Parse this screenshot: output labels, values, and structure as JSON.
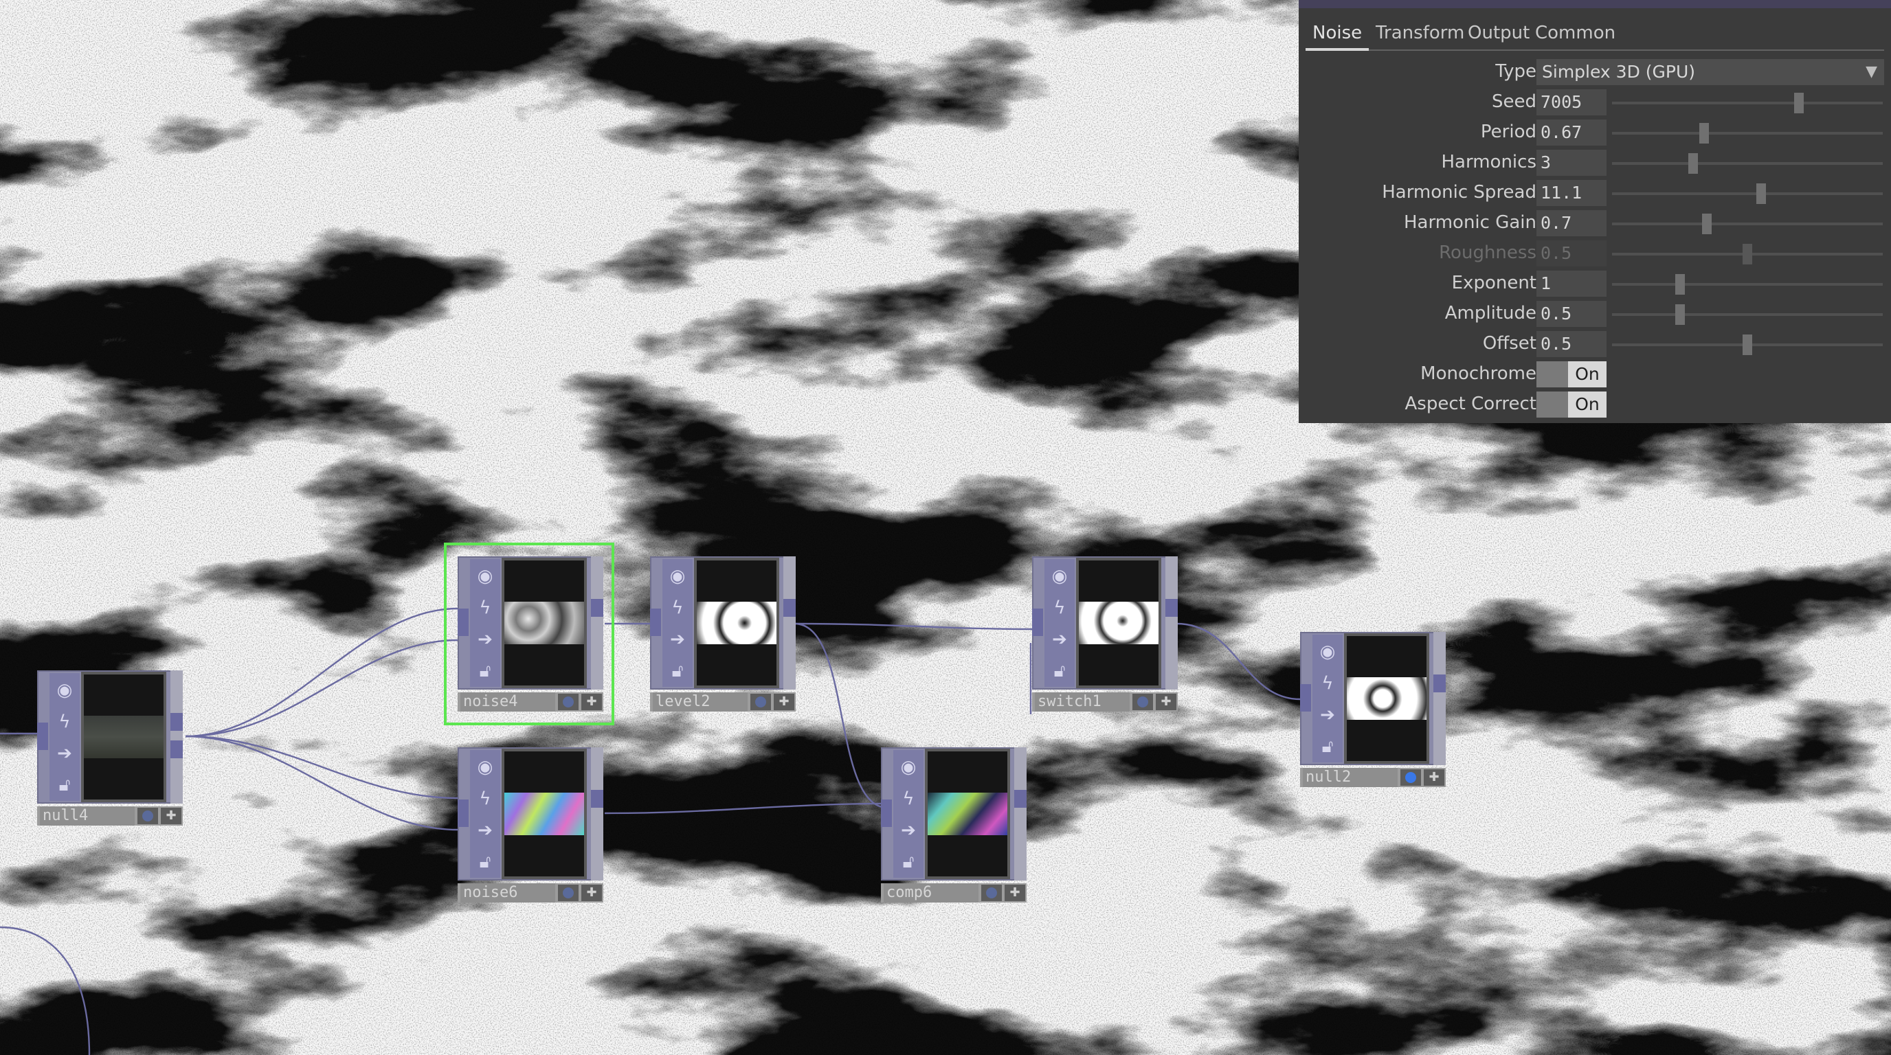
{
  "colors": {
    "panel_bg": "#3b3b3b",
    "node_purple": "#8a8aa8",
    "selection_green": "#5ce650",
    "wire": "#6a6aa0",
    "viewer_active_blue": "#3a78e8"
  },
  "nodes": [
    {
      "id": "null4",
      "name": "null4",
      "viewer": "dark-gray",
      "selected": false
    },
    {
      "id": "noise4",
      "name": "noise4",
      "viewer": "bw-noise",
      "selected": true
    },
    {
      "id": "level2",
      "name": "level2",
      "viewer": "bw-contrast",
      "selected": false
    },
    {
      "id": "noise6",
      "name": "noise6",
      "viewer": "color-noise",
      "selected": false
    },
    {
      "id": "switch1",
      "name": "switch1",
      "viewer": "bw-contrast",
      "selected": false
    },
    {
      "id": "comp6",
      "name": "comp6",
      "viewer": "color-noise-dark",
      "selected": false
    },
    {
      "id": "null2",
      "name": "null2",
      "viewer": "bw-contrast",
      "selected": false,
      "viewer_active": true
    }
  ],
  "node_icons": [
    "viewer-eye-icon",
    "bypass-icon",
    "cook-arrow-icon",
    "lock-icon"
  ],
  "panel": {
    "tabs": [
      "Noise",
      "Transform",
      "Output",
      "Common"
    ],
    "active_tab": "Noise",
    "params": [
      {
        "label": "Type",
        "kind": "menu",
        "value": "Simplex 3D (GPU)"
      },
      {
        "label": "Seed",
        "kind": "slider",
        "value": "7005",
        "slider_fraction": 0.69
      },
      {
        "label": "Period",
        "kind": "slider",
        "value": "0.67",
        "slider_fraction": 0.34
      },
      {
        "label": "Harmonics",
        "kind": "slider",
        "value": "3",
        "slider_fraction": 0.3
      },
      {
        "label": "Harmonic Spread",
        "kind": "slider",
        "value": "11.1",
        "slider_fraction": 0.55
      },
      {
        "label": "Harmonic Gain",
        "kind": "slider",
        "value": "0.7",
        "slider_fraction": 0.35
      },
      {
        "label": "Roughness",
        "kind": "slider",
        "value": "0.5",
        "slider_fraction": 0.5,
        "disabled": true
      },
      {
        "label": "Exponent",
        "kind": "slider",
        "value": "1",
        "slider_fraction": 0.25
      },
      {
        "label": "Amplitude",
        "kind": "slider",
        "value": "0.5",
        "slider_fraction": 0.25
      },
      {
        "label": "Offset",
        "kind": "slider",
        "value": "0.5",
        "slider_fraction": 0.5
      },
      {
        "label": "Monochrome",
        "kind": "toggle",
        "value": "On"
      },
      {
        "label": "Aspect Correct",
        "kind": "toggle",
        "value": "On"
      }
    ]
  }
}
